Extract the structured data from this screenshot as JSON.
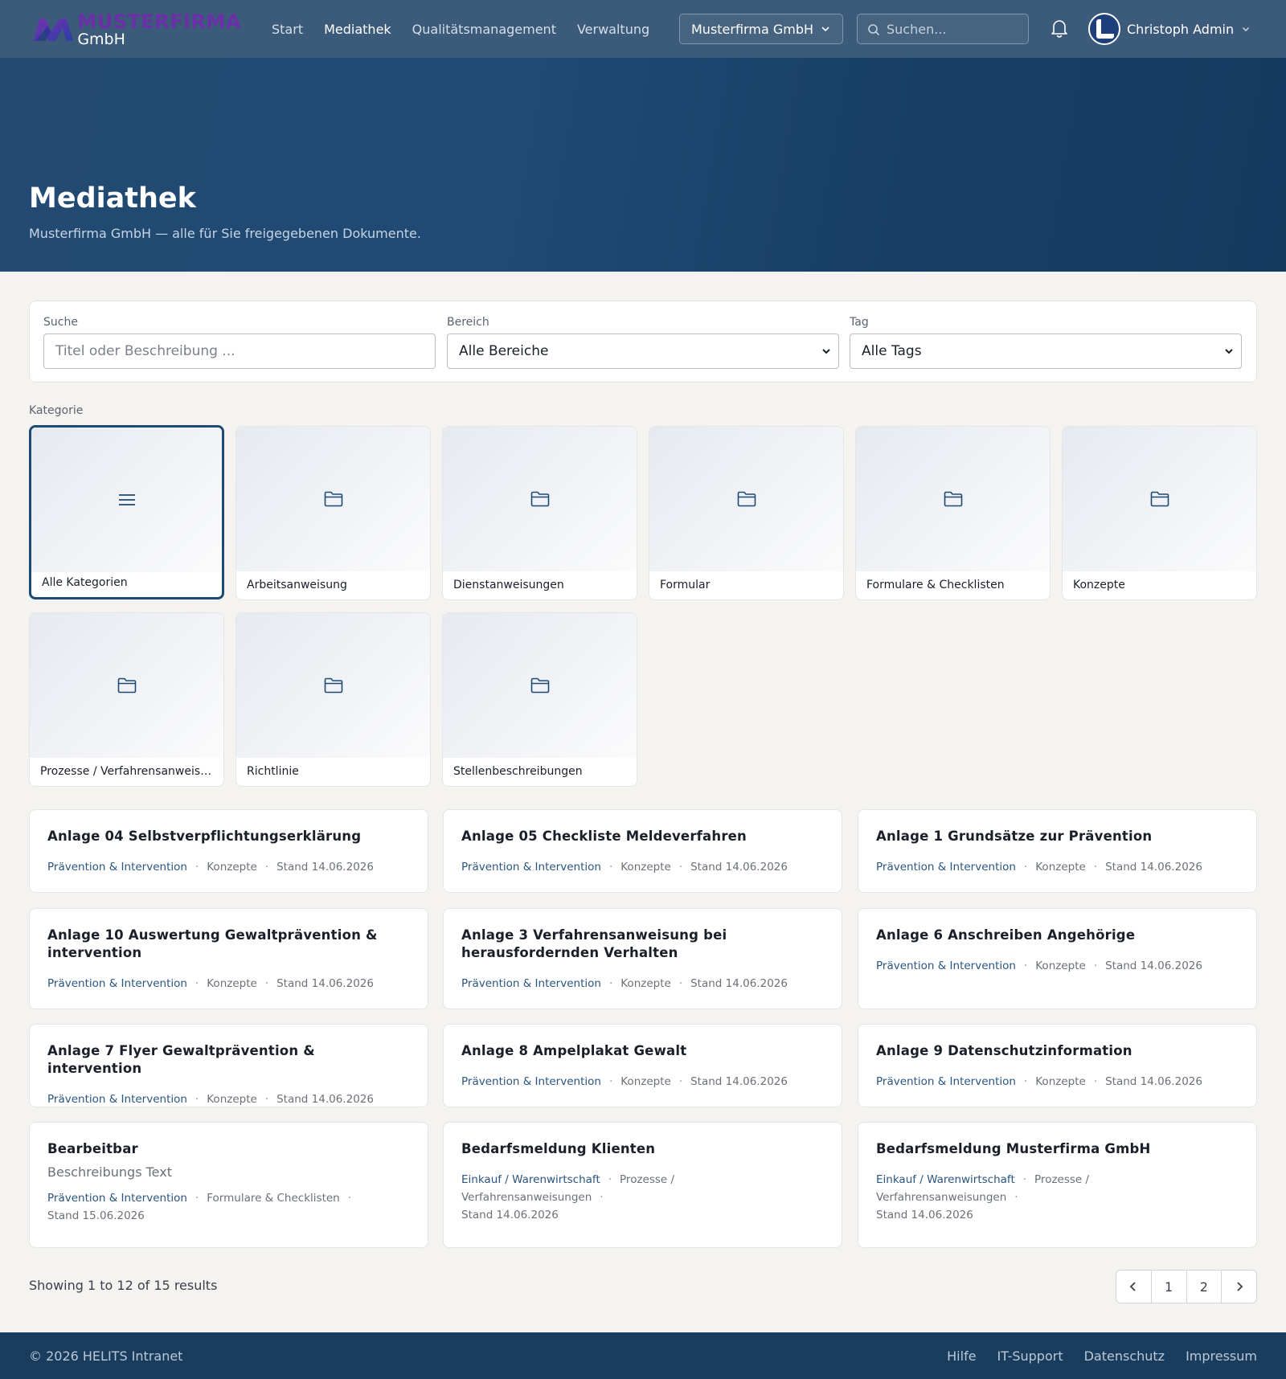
{
  "brand": {
    "line1": "MUSTERFIRMA",
    "line2": "GmbH",
    "accent": "#6b2fa8"
  },
  "nav": {
    "links": [
      "Start",
      "Mediathek",
      "Qualitätsmanagement",
      "Verwaltung"
    ],
    "active": "Mediathek",
    "org_selected": "Musterfirma GmbH",
    "search_placeholder": "Suchen...",
    "user_name": "Christoph Admin"
  },
  "hero": {
    "title": "Mediathek",
    "subtitle": "Musterfirma GmbH — alle für Sie freigegebenen Dokumente."
  },
  "filters": {
    "search_label": "Suche",
    "search_placeholder": "Titel oder Beschreibung ...",
    "area_label": "Bereich",
    "area_selected": "Alle Bereiche",
    "tag_label": "Tag",
    "tag_selected": "Alle Tags"
  },
  "categories": {
    "label": "Kategorie",
    "items": [
      {
        "label": "Alle Kategorien",
        "icon": "list-icon",
        "selected": true
      },
      {
        "label": "Arbeitsanweisung",
        "icon": "folder-icon"
      },
      {
        "label": "Dienstanweisungen",
        "icon": "folder-icon"
      },
      {
        "label": "Formular",
        "icon": "folder-icon"
      },
      {
        "label": "Formulare & Checklisten",
        "icon": "folder-icon"
      },
      {
        "label": "Konzepte",
        "icon": "folder-icon"
      },
      {
        "label": "Prozesse / Verfahrensanweisu...",
        "icon": "folder-icon"
      },
      {
        "label": "Richtlinie",
        "icon": "folder-icon"
      },
      {
        "label": "Stellenbeschreibungen",
        "icon": "folder-icon"
      }
    ]
  },
  "documents": [
    {
      "title": "Anlage 04 Selbstverpflichtungserklärung",
      "area": "Prävention & Intervention",
      "category": "Konzepte",
      "stand": "Stand 14.06.2026"
    },
    {
      "title": "Anlage 05 Checkliste Meldeverfahren",
      "area": "Prävention & Intervention",
      "category": "Konzepte",
      "stand": "Stand 14.06.2026"
    },
    {
      "title": "Anlage 1 Grundsätze zur Prävention",
      "area": "Prävention & Intervention",
      "category": "Konzepte",
      "stand": "Stand 14.06.2026"
    },
    {
      "title": "Anlage 10 Auswertung Gewaltprävention & intervention",
      "area": "Prävention & Intervention",
      "category": "Konzepte",
      "stand": "Stand 14.06.2026"
    },
    {
      "title": "Anlage 3 Verfahrensanweisung bei herausfordernden Verhalten",
      "area": "Prävention & Intervention",
      "category": "Konzepte",
      "stand": "Stand 14.06.2026"
    },
    {
      "title": "Anlage 6 Anschreiben Angehörige",
      "area": "Prävention & Intervention",
      "category": "Konzepte",
      "stand": "Stand 14.06.2026"
    },
    {
      "title": "Anlage 7 Flyer Gewaltprävention & intervention",
      "area": "Prävention & Intervention",
      "category": "Konzepte",
      "stand": "Stand 14.06.2026"
    },
    {
      "title": "Anlage 8 Ampelplakat Gewalt",
      "area": "Prävention & Intervention",
      "category": "Konzepte",
      "stand": "Stand 14.06.2026"
    },
    {
      "title": "Anlage 9 Datenschutzinformation",
      "area": "Prävention & Intervention",
      "category": "Konzepte",
      "stand": "Stand 14.06.2026"
    },
    {
      "title": "Bearbeitbar",
      "description": "Beschreibungs Text",
      "area": "Prävention & Intervention",
      "category": "Formulare & Checklisten",
      "stand": "Stand 15.06.2026"
    },
    {
      "title": "Bedarfsmeldung Klienten",
      "area": "Einkauf / Warenwirtschaft",
      "category": "Prozesse / Verfahrensanweisungen",
      "stand": "Stand 14.06.2026"
    },
    {
      "title": "Bedarfsmeldung Musterfirma GmbH",
      "area": "Einkauf / Warenwirtschaft",
      "category": "Prozesse / Verfahrensanweisungen",
      "stand": "Stand 14.06.2026"
    }
  ],
  "pagination": {
    "summary": "Showing 1 to 12 of 15 results",
    "pages": [
      "1",
      "2"
    ]
  },
  "footer": {
    "copyright": "© 2026 HELITS Intranet",
    "links": [
      "Hilfe",
      "IT-Support",
      "Datenschutz",
      "Impressum"
    ]
  },
  "colors": {
    "nav_bg": "#3c5a7a",
    "hero_bg": "#1f4a75",
    "accent_link": "#2a5580",
    "footer_bg": "#1a3d5e"
  }
}
